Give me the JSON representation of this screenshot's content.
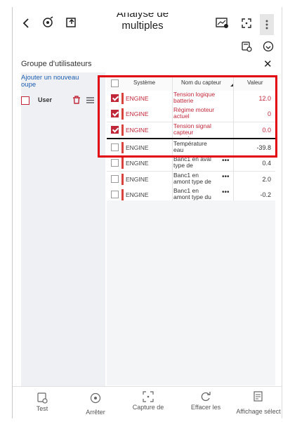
{
  "header": {
    "title_line1": "Analyse de données",
    "title_line2": "multiples",
    "icons": [
      "back-icon",
      "gps-signal-icon",
      "export-icon",
      "graph-icon",
      "fullscreen-icon",
      "more-icon",
      "vehicle-icon",
      "download-icon"
    ]
  },
  "group_panel": {
    "title": "Groupe d'utilisateurs",
    "close": "✕",
    "add_group": "Ajouter un nouveau\noupe",
    "user_label": "User"
  },
  "table": {
    "headers": {
      "system": "Système",
      "sensor": "Nom du capteur",
      "value": "Valeur"
    },
    "rows": [
      {
        "checked": true,
        "highlighted": true,
        "system": "ENGINE",
        "sensor": "Tension logique batterie",
        "value": "12.0",
        "dots": ""
      },
      {
        "checked": true,
        "highlighted": true,
        "system": "ENGINE",
        "sensor": "Régime moteur actuel",
        "value": "0",
        "dots": ""
      },
      {
        "checked": true,
        "highlighted": true,
        "system": "ENGINE",
        "sensor": "Tension signal capteur pression",
        "value": "0.0",
        "dots": ""
      },
      {
        "checked": false,
        "highlighted": false,
        "system": "ENGINE",
        "sensor": "Température eau",
        "value": "-39.8",
        "dots": ""
      },
      {
        "checked": false,
        "highlighted": false,
        "system": "ENGINE",
        "sensor": "Banc1 en aval type de",
        "value": "0.4",
        "dots": "•••"
      },
      {
        "checked": false,
        "highlighted": false,
        "system": "ENGINE",
        "sensor": "Banc1 en amont type de",
        "value": "2.0",
        "dots": "•••"
      },
      {
        "checked": false,
        "highlighted": false,
        "system": "ENGINE",
        "sensor": "Banc1 en amont type du",
        "value": "-0.2",
        "dots": "•••"
      }
    ]
  },
  "toolbar": {
    "test": "Test",
    "stop": "Arrêter",
    "capture": "Capture de",
    "clear": "Effacer les",
    "display": "Affichage sélect"
  },
  "colors": {
    "accent": "#c0283a",
    "highlight_box": "#e10012",
    "link": "#1f5fb0"
  }
}
